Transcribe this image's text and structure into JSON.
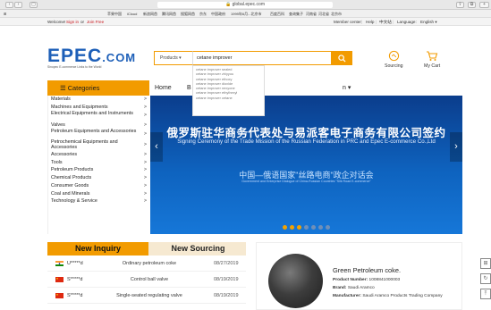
{
  "browser": {
    "url": "global.epec.com",
    "back_glyph": "‹",
    "forward_glyph": "›",
    "sidebar_glyph": "▢",
    "bookmarks": [
      "苹果中国",
      "iCloud",
      "新浪网首",
      "腾讯网首",
      "搜狐网首",
      "京东",
      "中国政府",
      "1999年6月...北京市",
      "百度百科",
      "查询集子",
      "河南省",
      "河北省",
      "北京市"
    ]
  },
  "topbar": {
    "welcome": "Welcome!",
    "sign_in": "Sign in",
    "or": "or",
    "join_free": "Join Free",
    "member_center": "Member center",
    "help": "Help",
    "chinese": "中文站",
    "language_label": "Language:",
    "language_value": "English"
  },
  "logo": {
    "text": "EPEC",
    "com": ".COM",
    "tagline": "Sinopec E-commerce Links to the World"
  },
  "search": {
    "category": "Products",
    "query": "cetane improver",
    "suggestions": [
      "cetane improver sealed",
      "cetane improver zhiyyou",
      "cetane improver ethoxy",
      "cetane improver dioxide",
      "cetane improver nexyone",
      "cetane improver ethylhexyl",
      "cetane improver cetane"
    ]
  },
  "tools": {
    "sourcing": "Sourcing",
    "cart": "My Cart"
  },
  "nav": {
    "categories": "Categories",
    "home": "Home",
    "b_label": "B",
    "n_label": "n"
  },
  "sidebar": {
    "items": [
      "Materials",
      "Machines and Equipments",
      "Electrical Equipments and Instruments",
      "Valves",
      "Petroleum Equipments and Accessories",
      "Petrochemical Equipments and Accessories",
      "Accessories",
      "Tools",
      "Petroleum Products",
      "Chemical Products",
      "Consumer Goods",
      "Coal and Minerals",
      "Technology & Service"
    ]
  },
  "banner": {
    "title_zh": "俄罗斯驻华商务代表处与易派客电子商务有限公司签约",
    "title_en": "Signing Ceremony of the Trade Mission of the Russian Federation in PRC and Epec E-commerce Co.,Ltd",
    "sub_zh": "中国—俄语国家\"丝路电商\"政企对话会",
    "sub_en": "Government and Enterprise Dialogue of China-Russian Countries \"Silk Road E-commerce\""
  },
  "inquiry": {
    "tab_new": "New Inquiry",
    "tab_sourcing": "New Sourcing",
    "rows": [
      {
        "flag": "india",
        "who": "U*****d",
        "what": "Ordinary petroleum coke",
        "date": "08/27/2019"
      },
      {
        "flag": "china",
        "who": "S*****d",
        "what": "Control ball valve",
        "date": "08/19/2019"
      },
      {
        "flag": "china",
        "who": "S*****d",
        "what": "Single-seated regulating valve",
        "date": "08/19/2019"
      }
    ]
  },
  "product": {
    "title": "Green Petroleum coke.",
    "number_label": "Product Number:",
    "number": "1008841000003",
    "brand_label": "Brand:",
    "brand": "Saudi Aramco",
    "manufacturer_label": "Manufacturer:",
    "manufacturer": "Saudi Aramco Products Trading Company"
  },
  "float_icons": [
    "cart-float-icon",
    "refresh-float-icon",
    "back-to-top-icon"
  ],
  "colors": {
    "accent": "#f29b00",
    "brand_blue": "#1d5fb8",
    "banner_blue": "#0e63bf"
  }
}
